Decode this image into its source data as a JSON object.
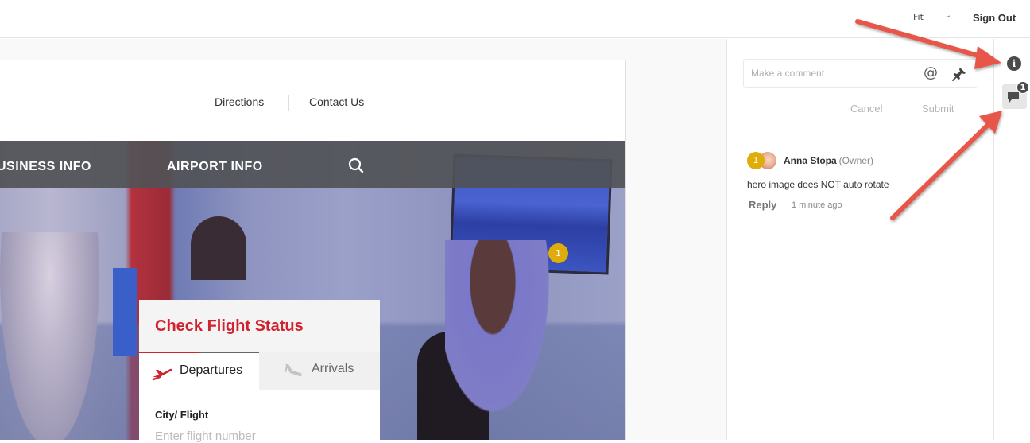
{
  "topbar": {
    "zoom_select": {
      "value": "Fit",
      "chevron_icon": "chevron-down-icon"
    },
    "sign_out_label": "Sign Out"
  },
  "site": {
    "utility_links": [
      {
        "label": "Directions"
      },
      {
        "label": "Contact Us"
      }
    ],
    "nav": [
      {
        "label": "USINESS INFO"
      },
      {
        "label": "AIRPORT INFO"
      }
    ],
    "search_icon": "search-icon",
    "pin_marker_number": "1",
    "flight_widget": {
      "title": "Check Flight Status",
      "tabs": [
        {
          "label": "Departures",
          "icon": "plane-takeoff-icon",
          "active": true
        },
        {
          "label": "Arrivals",
          "icon": "plane-landing-icon",
          "active": false
        }
      ],
      "field_label": "City/ Flight",
      "field_placeholder": "Enter flight number"
    }
  },
  "comments": {
    "input_placeholder": "Make a comment",
    "mention_icon": "at-icon",
    "pin_icon": "pin-icon",
    "cancel_label": "Cancel",
    "submit_label": "Submit",
    "items": [
      {
        "number": "1",
        "author": "Anna Stopa",
        "role": "(Owner)",
        "text": "hero image does NOT auto rotate",
        "reply_label": "Reply",
        "time": "1 minute ago"
      }
    ]
  },
  "rail": {
    "info_icon": "info-icon",
    "comments_icon": "comments-icon",
    "comments_badge": "1"
  },
  "colors": {
    "brand_red": "#d0232f",
    "marker_yellow": "#e0ac0a",
    "arrow_red": "#e8574a",
    "nav_gray": "#505256"
  }
}
